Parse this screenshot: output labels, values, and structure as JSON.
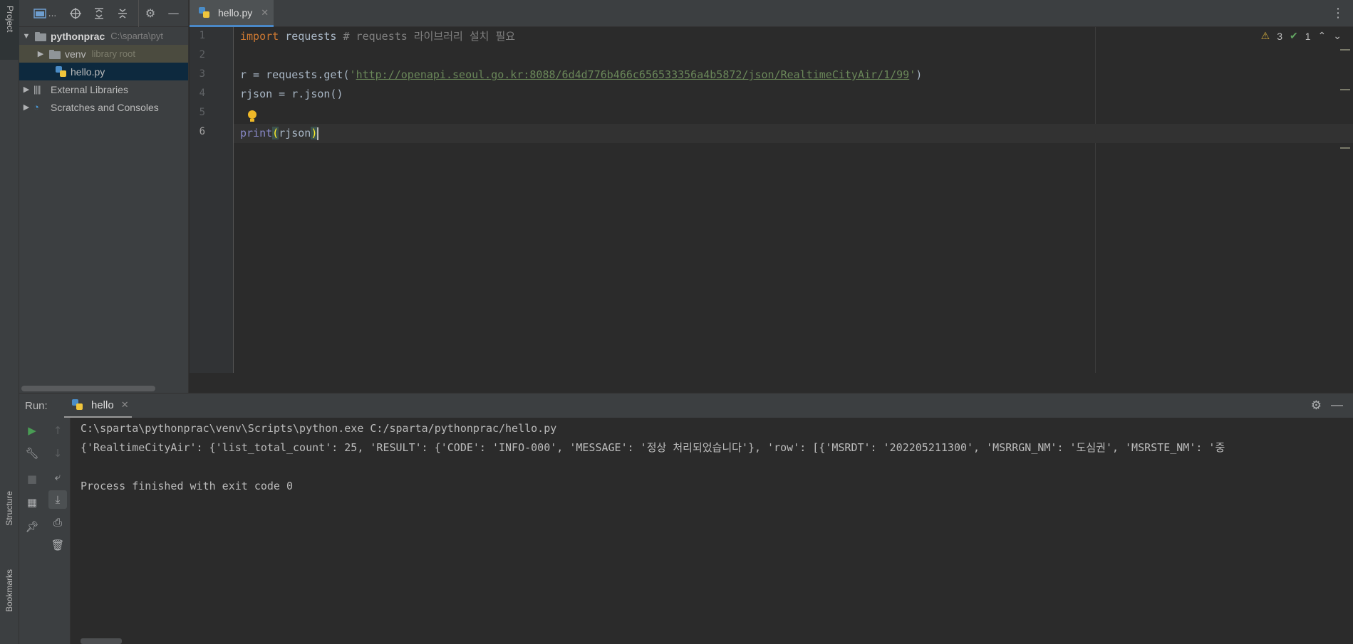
{
  "left_strip": {
    "project_tab": "Project",
    "structure_tab": "Structure",
    "bookmarks_tab": "Bookmarks"
  },
  "project_panel": {
    "toolbar_icons": [
      "project-view-icon",
      "locate-icon",
      "expand-all-icon",
      "collapse-all-icon",
      "gear-icon",
      "hide-icon"
    ],
    "view_dropdown_label": "...",
    "tree": [
      {
        "name": "pythonprac",
        "hint": "C:\\sparta\\pyt",
        "type": "folder",
        "expanded": true
      },
      {
        "name": "venv",
        "hint": "library root",
        "type": "folder",
        "expanded": false
      },
      {
        "name": "hello.py",
        "hint": "",
        "type": "python-file"
      },
      {
        "name": "External Libraries",
        "hint": "",
        "type": "libraries"
      },
      {
        "name": "Scratches and Consoles",
        "hint": "",
        "type": "scratches"
      }
    ]
  },
  "editor": {
    "tab_title": "hello.py",
    "warnings_count": "3",
    "typos_count": "1",
    "line_numbers": [
      "1",
      "2",
      "3",
      "4",
      "5",
      "6"
    ],
    "current_line": "6",
    "lines": {
      "l1_kw": "import",
      "l1_rest": " requests",
      "l1_comment": " # requests 라이브러리 설치 필요",
      "l3_pre": "r = requests.get(",
      "l3_q1": "'",
      "l3_url": "http://openapi.seoul.go.kr:8088/6d4d776b466c656533356a4b5872/json/RealtimeCityAir/1/99",
      "l3_q2": "'",
      "l3_post": ")",
      "l4": "rjson = r.json()",
      "l6_fn": "print",
      "l6_open": "(",
      "l6_arg": "rjson",
      "l6_close": ")"
    }
  },
  "run_panel": {
    "label": "Run:",
    "tab_title": "hello",
    "console": [
      "C:\\sparta\\pythonprac\\venv\\Scripts\\python.exe C:/sparta/pythonprac/hello.py",
      "{'RealtimeCityAir': {'list_total_count': 25, 'RESULT': {'CODE': 'INFO-000', 'MESSAGE': '정상 처리되었습니다'}, 'row': [{'MSRDT': '202205211300', 'MSRRGN_NM': '도심권', 'MSRSTE_NM': '중",
      "",
      "Process finished with exit code 0"
    ]
  },
  "colors": {
    "background": "#2b2b2b",
    "panel": "#3c3f41",
    "keyword": "#cc7832",
    "string": "#6a8759",
    "comment": "#808080",
    "builtin": "#8888c6",
    "accent": "#4a88c7"
  }
}
